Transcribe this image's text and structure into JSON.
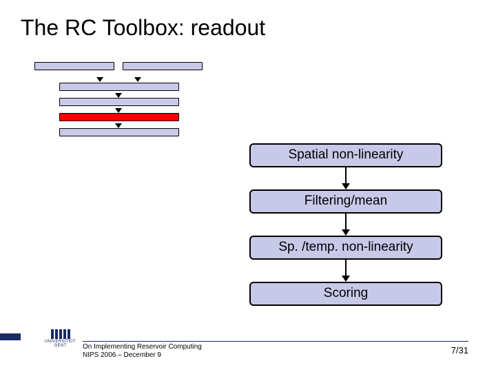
{
  "title": "The RC Toolbox: readout",
  "boxes": {
    "b1": "Spatial non-linearity",
    "b2": "Filtering/mean",
    "b3": "Sp. /temp. non-linearity",
    "b4": "Scoring"
  },
  "logo": {
    "line1": "UNIVERSITEIT",
    "line2": "GENT"
  },
  "footer": {
    "line1": "On Implementing Reservoir Computing",
    "line2": "NIPS 2006 – December 9"
  },
  "page": "7/31"
}
